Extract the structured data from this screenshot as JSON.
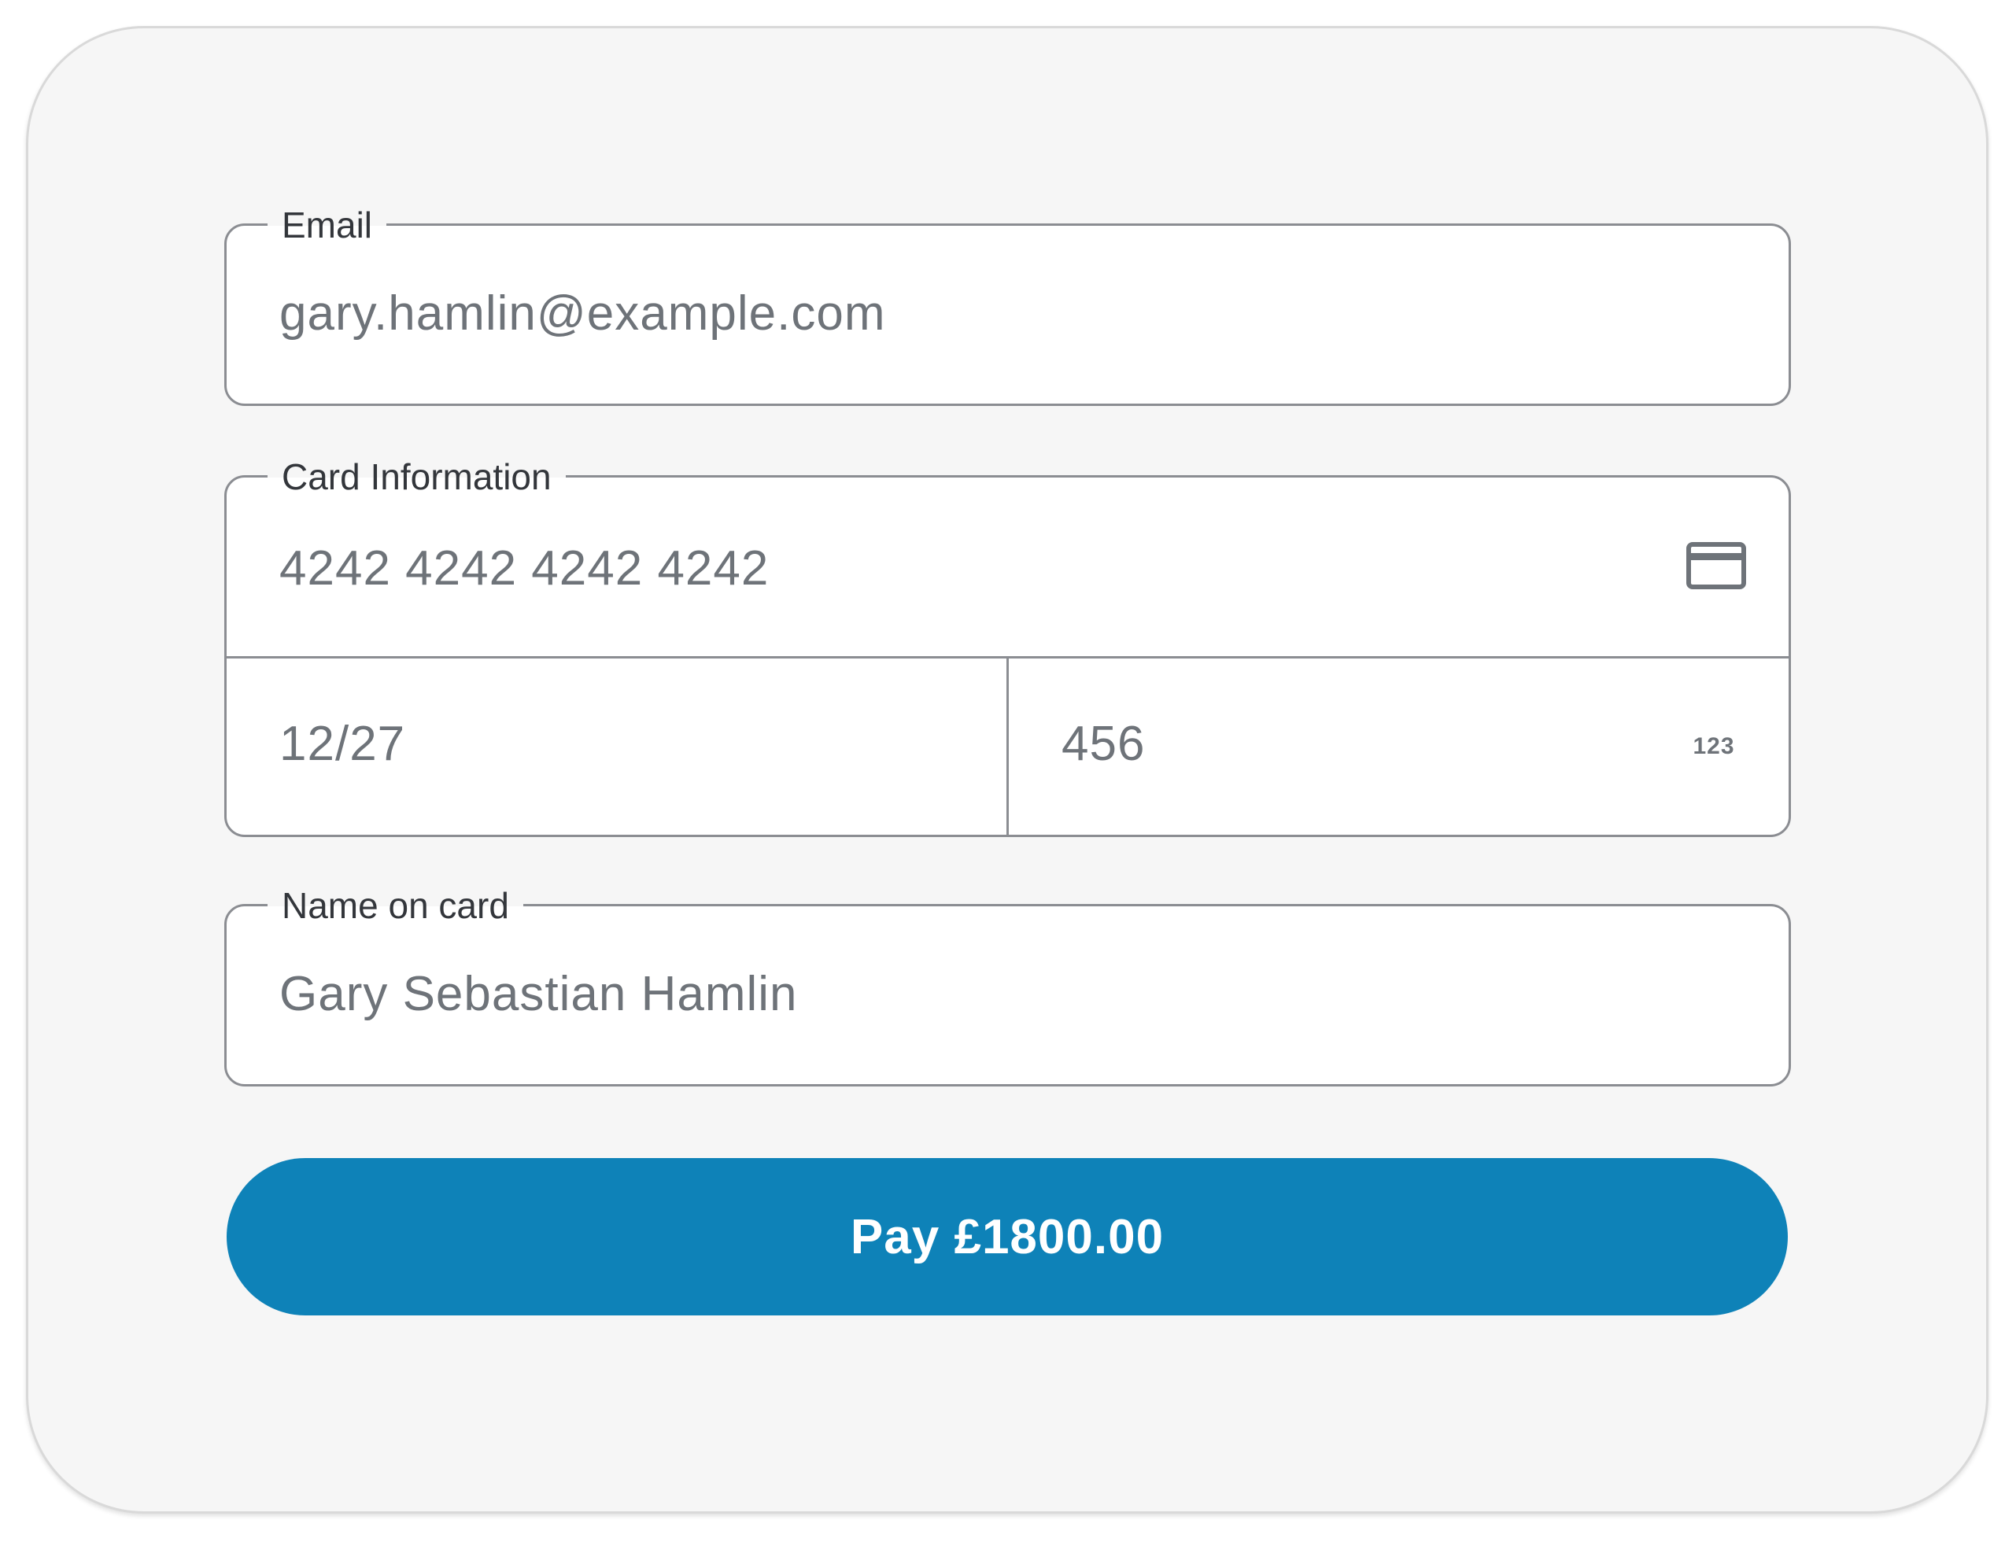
{
  "form": {
    "email": {
      "label": "Email",
      "value": "gary.hamlin@example.com"
    },
    "card": {
      "label": "Card Information",
      "number": "4242 4242 4242 4242",
      "number_icon": "credit-card-icon",
      "expiry": "12/27",
      "cvc": "456",
      "cvc_icon": "cvc-123-icon",
      "cvc_icon_text": "123"
    },
    "name": {
      "label": "Name on card",
      "value": "Gary Sebastian Hamlin"
    },
    "pay_button": {
      "label": "Pay £1800.00",
      "color": "#0e82b8"
    }
  }
}
